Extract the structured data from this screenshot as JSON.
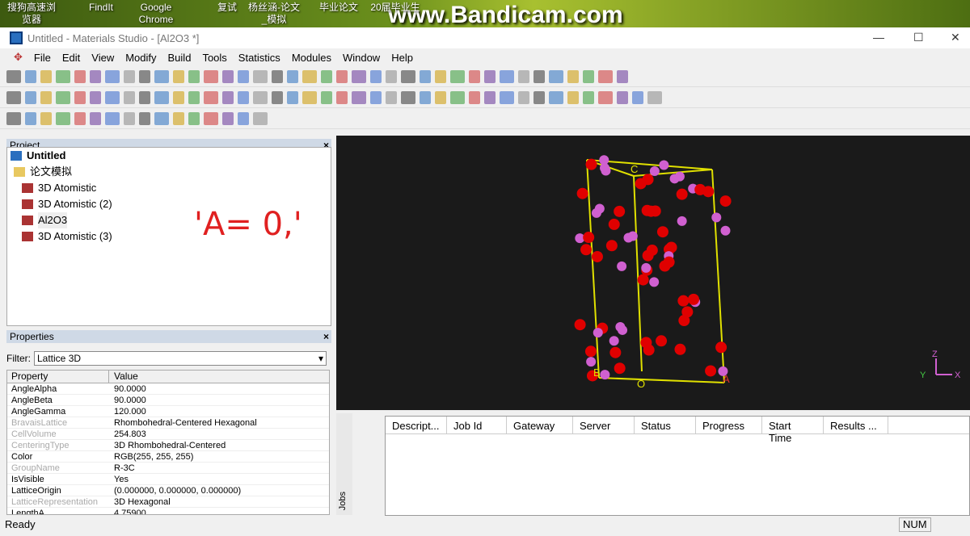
{
  "desktop": {
    "icons": [
      "搜狗高速浏览器",
      "FindIt",
      "Google Chrome",
      "复试",
      "杨丝涵-论文_模拟",
      "毕业论文",
      "20届毕业生"
    ],
    "watermark": "www.Bandicam.com"
  },
  "window": {
    "title": "Untitled - Materials Studio - [Al2O3 *]"
  },
  "menu": [
    "File",
    "Edit",
    "View",
    "Modify",
    "Build",
    "Tools",
    "Statistics",
    "Modules",
    "Window",
    "Help"
  ],
  "project": {
    "header": "Project",
    "root": "Untitled",
    "items": [
      "论文模拟",
      "3D Atomistic",
      "3D Atomistic (2)",
      "Al2O3",
      "3D Atomistic (3)"
    ]
  },
  "annotation": "'A=  0,'",
  "properties": {
    "header": "Properties",
    "filter_label": "Filter:",
    "filter_value": "Lattice 3D",
    "col_property": "Property",
    "col_value": "Value",
    "rows": [
      {
        "k": "AngleAlpha",
        "v": "90.0000",
        "dim": false
      },
      {
        "k": "AngleBeta",
        "v": "90.0000",
        "dim": false
      },
      {
        "k": "AngleGamma",
        "v": "120.000",
        "dim": false
      },
      {
        "k": "BravaisLattice",
        "v": "Rhombohedral-Centered Hexagonal",
        "dim": true
      },
      {
        "k": "CellVolume",
        "v": "254.803",
        "dim": true
      },
      {
        "k": "CenteringType",
        "v": "3D Rhombohedral-Centered",
        "dim": true
      },
      {
        "k": "Color",
        "v": "RGB(255, 255, 255)",
        "dim": false
      },
      {
        "k": "GroupName",
        "v": "R-3C",
        "dim": true
      },
      {
        "k": "IsVisible",
        "v": "Yes",
        "dim": false
      },
      {
        "k": "LatticeOrigin",
        "v": "(0.000000, 0.000000, 0.000000)",
        "dim": false
      },
      {
        "k": "LatticeRepresentation",
        "v": "3D Hexagonal",
        "dim": true
      },
      {
        "k": "LengthA",
        "v": "4.75900",
        "dim": false
      }
    ]
  },
  "viewer": {
    "labels": {
      "a": "A",
      "b": "B",
      "c": "C",
      "o": "O"
    },
    "axes": {
      "x": "X",
      "y": "Y",
      "z": "Z"
    },
    "colors": {
      "al": "#d060d0",
      "o": "#e00000",
      "cell": "#e0e000"
    }
  },
  "jobs": {
    "tab": "Jobs",
    "columns": [
      "Descript...",
      "Job Id",
      "Gateway",
      "Server",
      "Status",
      "Progress",
      "Start Time",
      "Results ..."
    ]
  },
  "status": {
    "text": "Ready",
    "num": "NUM"
  }
}
